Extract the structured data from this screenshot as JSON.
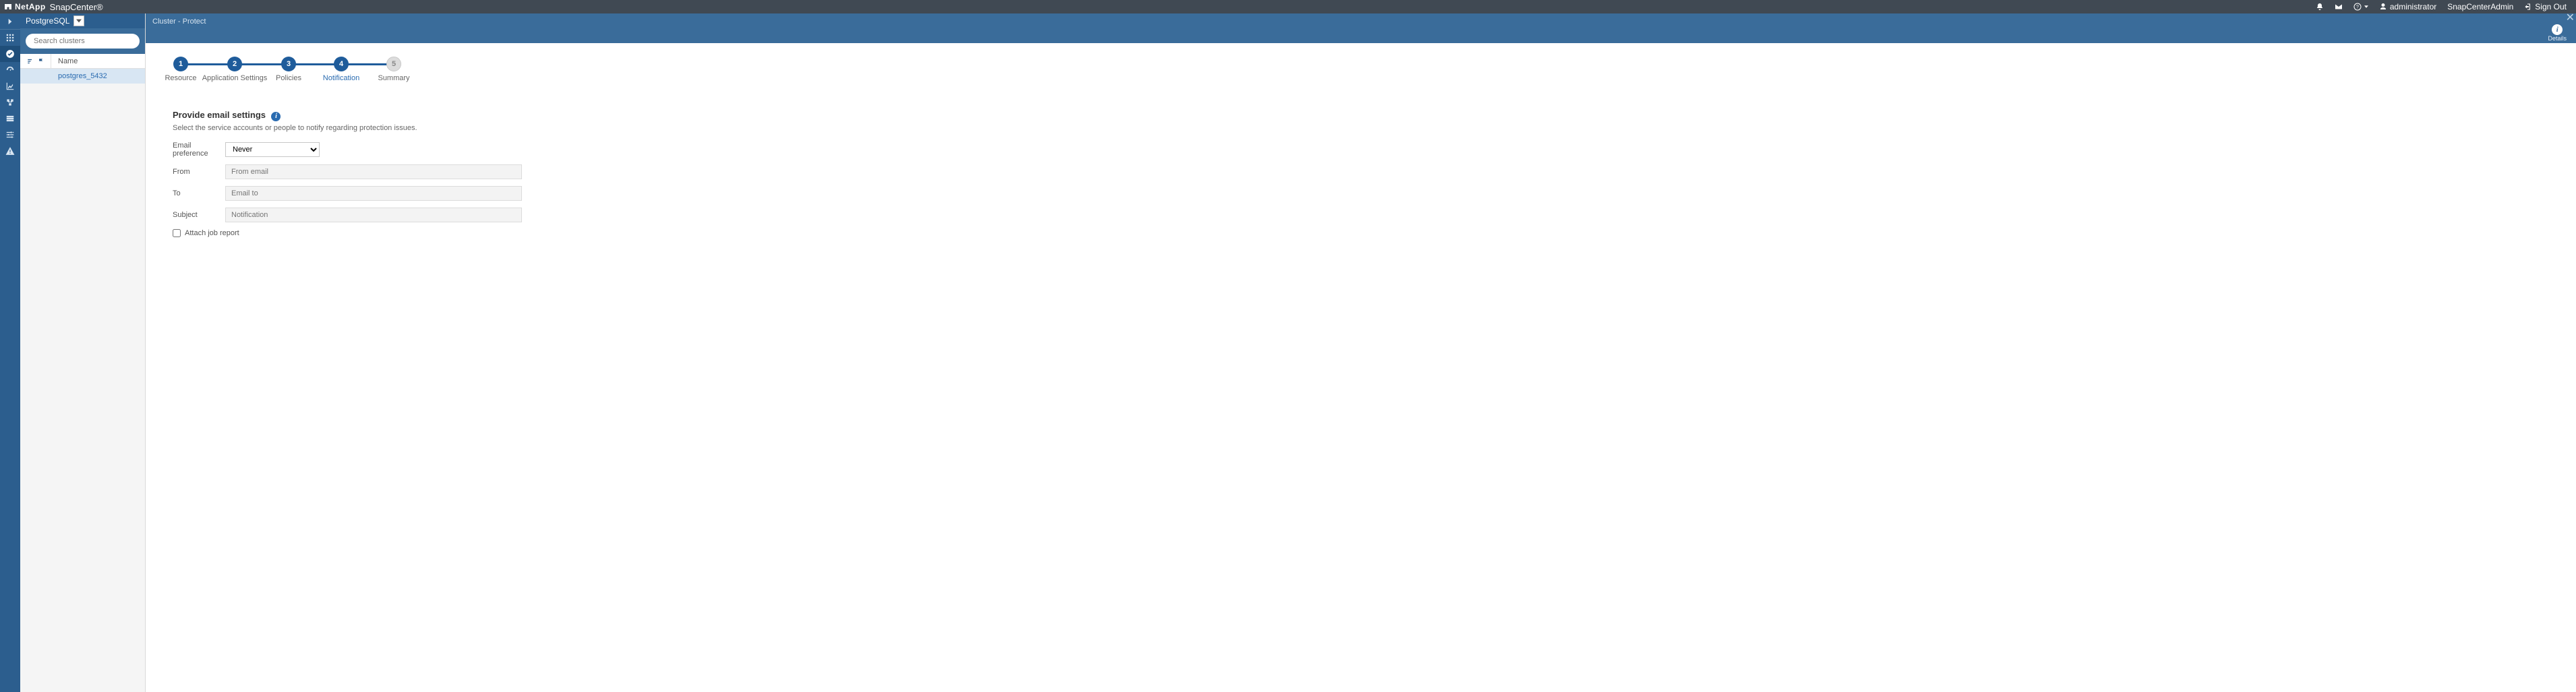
{
  "brand": {
    "company": "NetApp",
    "product": "SnapCenter®"
  },
  "topbar": {
    "user": "administrator",
    "role": "SnapCenterAdmin",
    "signout": "Sign Out"
  },
  "sidebar": {
    "plugin_label": "PostgreSQL",
    "search_placeholder": "Search clusters",
    "columns": {
      "name": "Name"
    },
    "rows": [
      {
        "name": "postgres_5432"
      }
    ]
  },
  "crumb": {
    "text": "Cluster - Protect",
    "details": "Details"
  },
  "wizard": {
    "steps": [
      {
        "num": "1",
        "label": "Resource"
      },
      {
        "num": "2",
        "label": "Application Settings"
      },
      {
        "num": "3",
        "label": "Policies"
      },
      {
        "num": "4",
        "label": "Notification"
      },
      {
        "num": "5",
        "label": "Summary"
      }
    ],
    "current_index": 3
  },
  "form": {
    "title": "Provide email settings",
    "subtitle": "Select the service accounts or people to notify regarding protection issues.",
    "email_pref_label": "Email preference",
    "email_pref_value": "Never",
    "email_pref_options": [
      "Never"
    ],
    "from_label": "From",
    "from_placeholder": "From email",
    "to_label": "To",
    "to_placeholder": "Email to",
    "subject_label": "Subject",
    "subject_placeholder": "Notification",
    "attach_label": "Attach job report"
  }
}
